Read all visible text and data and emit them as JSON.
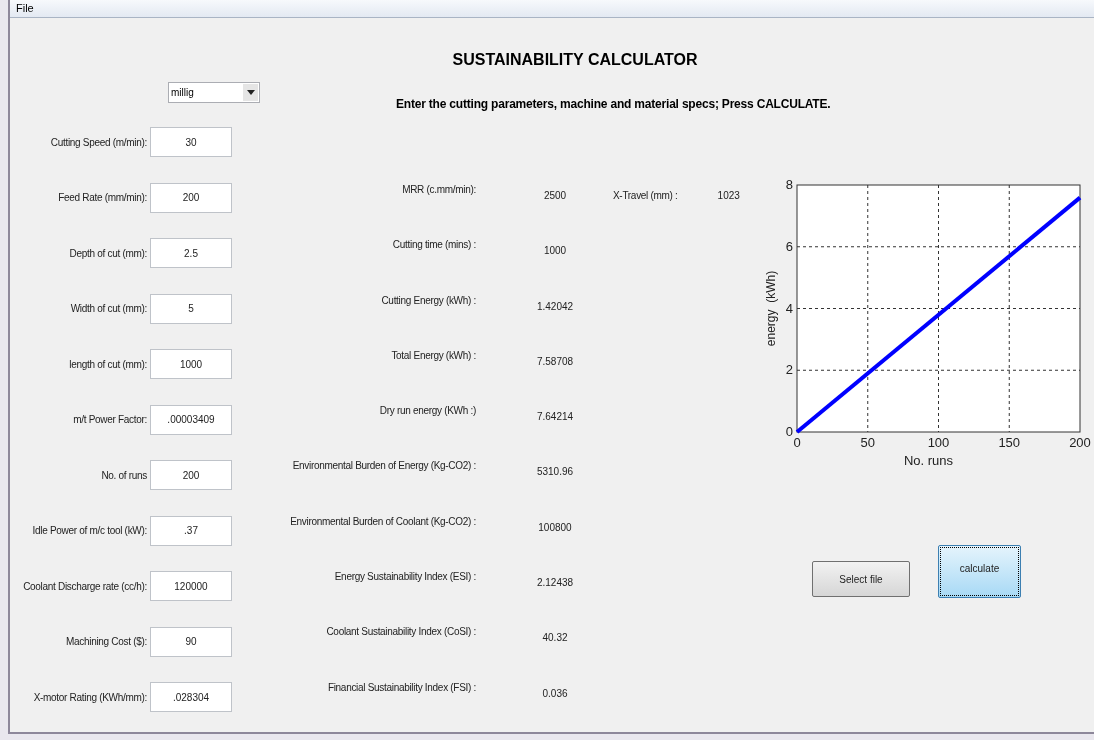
{
  "menu": [
    {
      "label": "File"
    }
  ],
  "title": "SUSTAINABILITY CALCULATOR",
  "instruction": "Enter the cutting parameters, machine and material specs; Press CALCULATE.",
  "mode_select": {
    "value": "millig"
  },
  "inputs": [
    {
      "label": "Cutting Speed (m/min):",
      "value": "30"
    },
    {
      "label": "Feed Rate (mm/min):",
      "value": "200"
    },
    {
      "label": "Depth of cut (mm):",
      "value": "2.5"
    },
    {
      "label": "Width of cut (mm):",
      "value": "5"
    },
    {
      "label": "length of cut (mm):",
      "value": "1000"
    },
    {
      "label": "m/t Power Factor:",
      "value": ".00003409"
    },
    {
      "label": "No. of runs",
      "value": "200"
    },
    {
      "label": "Idle Power of m/c tool (kW):",
      "value": ".37"
    },
    {
      "label": "Coolant Discharge rate (cc/h):",
      "value": "120000"
    },
    {
      "label": "Machining Cost ($):",
      "value": "90"
    },
    {
      "label": "X-motor Rating (KWh/mm):",
      "value": ".028304"
    }
  ],
  "outputs": [
    {
      "label": "MRR (c.mm/min):",
      "value": "2500"
    },
    {
      "label": "Cutting time (mins) :",
      "value": "1000"
    },
    {
      "label": "Cutting Energy (kWh) :",
      "value": "1.42042"
    },
    {
      "label": "Total Energy (kWh) :",
      "value": "7.58708"
    },
    {
      "label": "Dry run energy (KWh :)",
      "value": "7.64214"
    },
    {
      "label": "Environmental Burden of Energy (Kg-CO2) :",
      "value": "5310.96"
    },
    {
      "label": "Environmental Burden of Coolant (Kg-CO2) :",
      "value": "100800"
    },
    {
      "label": "Energy Sustainability Index (ESI) :",
      "value": "2.12438"
    },
    {
      "label": "Coolant Sustainability Index (CoSI) :",
      "value": "40.32"
    },
    {
      "label": "Financial Sustainability Index (FSI) :",
      "value": "0.036"
    }
  ],
  "x_travel": {
    "label": "X-Travel (mm) :",
    "value": "1023"
  },
  "chart": {
    "chart_data": {
      "type": "line",
      "xlabel": "No. runs",
      "ylabel": "energy  (kWh)",
      "x": [
        0,
        200
      ],
      "series": [
        {
          "color": "#0000ff",
          "values": [
            0,
            7.59
          ]
        }
      ],
      "grid": true,
      "xlim": [
        0,
        200
      ],
      "ylim": [
        0,
        8
      ],
      "xticks": [
        0,
        50,
        100,
        150,
        200
      ],
      "yticks": [
        0,
        2,
        4,
        6,
        8
      ]
    }
  },
  "buttons": [
    {
      "label": "Select file",
      "focused": false
    },
    {
      "label": "calculate",
      "focused": true
    }
  ]
}
